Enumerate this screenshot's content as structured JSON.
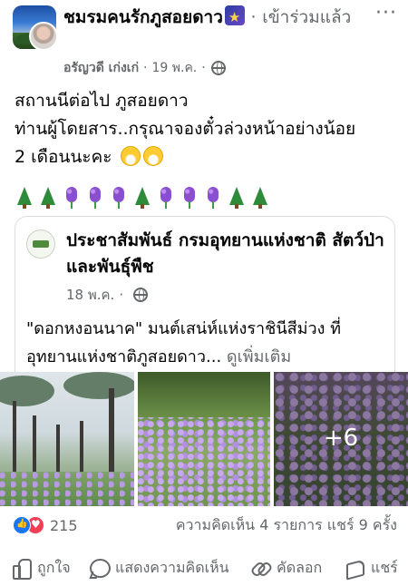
{
  "post": {
    "group_name": "ชมรมคนรักภูสอยดาว",
    "join_label": "เข้าร่วมแล้ว",
    "separator": "·",
    "author": "อรัญวดี เก่งเก่",
    "date": "19 พ.ค.",
    "more_icon": "more-options-icon",
    "text_lines": [
      "สถานนีต่อไป ภูสอยดาว",
      "ท่านผู้โดยสาร..กรุณาจองตั๋วล่วงหน้าอย่างน้อย",
      "2 เดือนนะคะ"
    ],
    "emoji_row": [
      "tree",
      "tree",
      "hyacinth",
      "hyacinth",
      "hyacinth",
      "tree",
      "hyacinth",
      "hyacinth",
      "hyacinth",
      "tree",
      "tree"
    ]
  },
  "shared": {
    "page_name": "ประชาสัมพันธ์ กรมอุทยานแห่งชาติ สัตว์ป่า และพันธุ์พืช",
    "date": "18 พ.ค.",
    "text": "\"ดอกหงอนนาค\" มนต์เสน่ห์แห่งราชินีสีม่วง ที่อุทยานแห่งชาติภูสอยดาว...",
    "see_more": "ดูเพิ่มเติม"
  },
  "photos": {
    "more_count": "+6"
  },
  "reactions": {
    "count": "215",
    "summary": "ความคิดเห็น 4 รายการ  แชร์ 9 ครั้ง"
  },
  "actions": {
    "like": "ถูกใจ",
    "comment": "แสดงความคิดเห็น",
    "copy": "คัดลอก",
    "share": "แชร์"
  },
  "colors": {
    "text": "#050505",
    "secondary": "#65676b",
    "like_blue": "#1877f2",
    "love_red": "#f33e58"
  }
}
